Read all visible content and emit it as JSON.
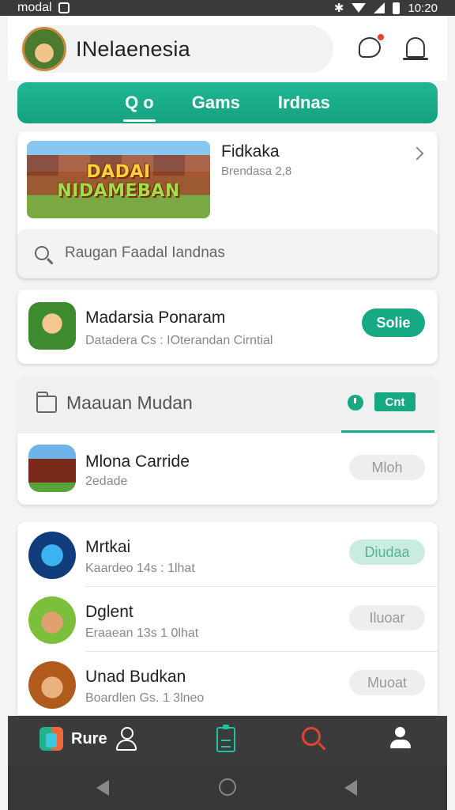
{
  "status_bar": {
    "left_label": "modal",
    "time": "10:20"
  },
  "header": {
    "title": "INelaenesia"
  },
  "tabs": [
    {
      "label": "Q o"
    },
    {
      "label": "Gams"
    },
    {
      "label": "Irdnas"
    }
  ],
  "featured": {
    "banner_line1": "DADAI",
    "banner_line2": "NIDAMEBAN",
    "title": "Fidkaka",
    "subtitle": "Brendasa 2,8"
  },
  "search": {
    "placeholder": "Raugan Faadal Iandnas"
  },
  "app_card": {
    "title": "Madarsia Ponaram",
    "subtitle": "Datadera Cs : IOterandan Cirntial",
    "button": "Solie"
  },
  "section": {
    "title": "Maauan Mudan",
    "button": "Cnt"
  },
  "single_item": {
    "title": "Mlona Carride",
    "subtitle": "2edade",
    "button": "Mloh"
  },
  "list_items": [
    {
      "title": "Mrtkai",
      "subtitle": "Kaardeo 14s : 1lhat",
      "button": "Diudaa"
    },
    {
      "title": "Dglent",
      "subtitle": "Eraaean 13s 1 0lhat",
      "button": "Iluoar"
    },
    {
      "title": "Unad Budkan",
      "subtitle": "Boardlen Gs. 1 3lneo",
      "button": "Muoat"
    }
  ],
  "bottom_nav": {
    "label": "Rure"
  },
  "colors": {
    "accent": "#17a884",
    "nav_bg": "#3b3b3b",
    "notification": "#e2442f"
  }
}
